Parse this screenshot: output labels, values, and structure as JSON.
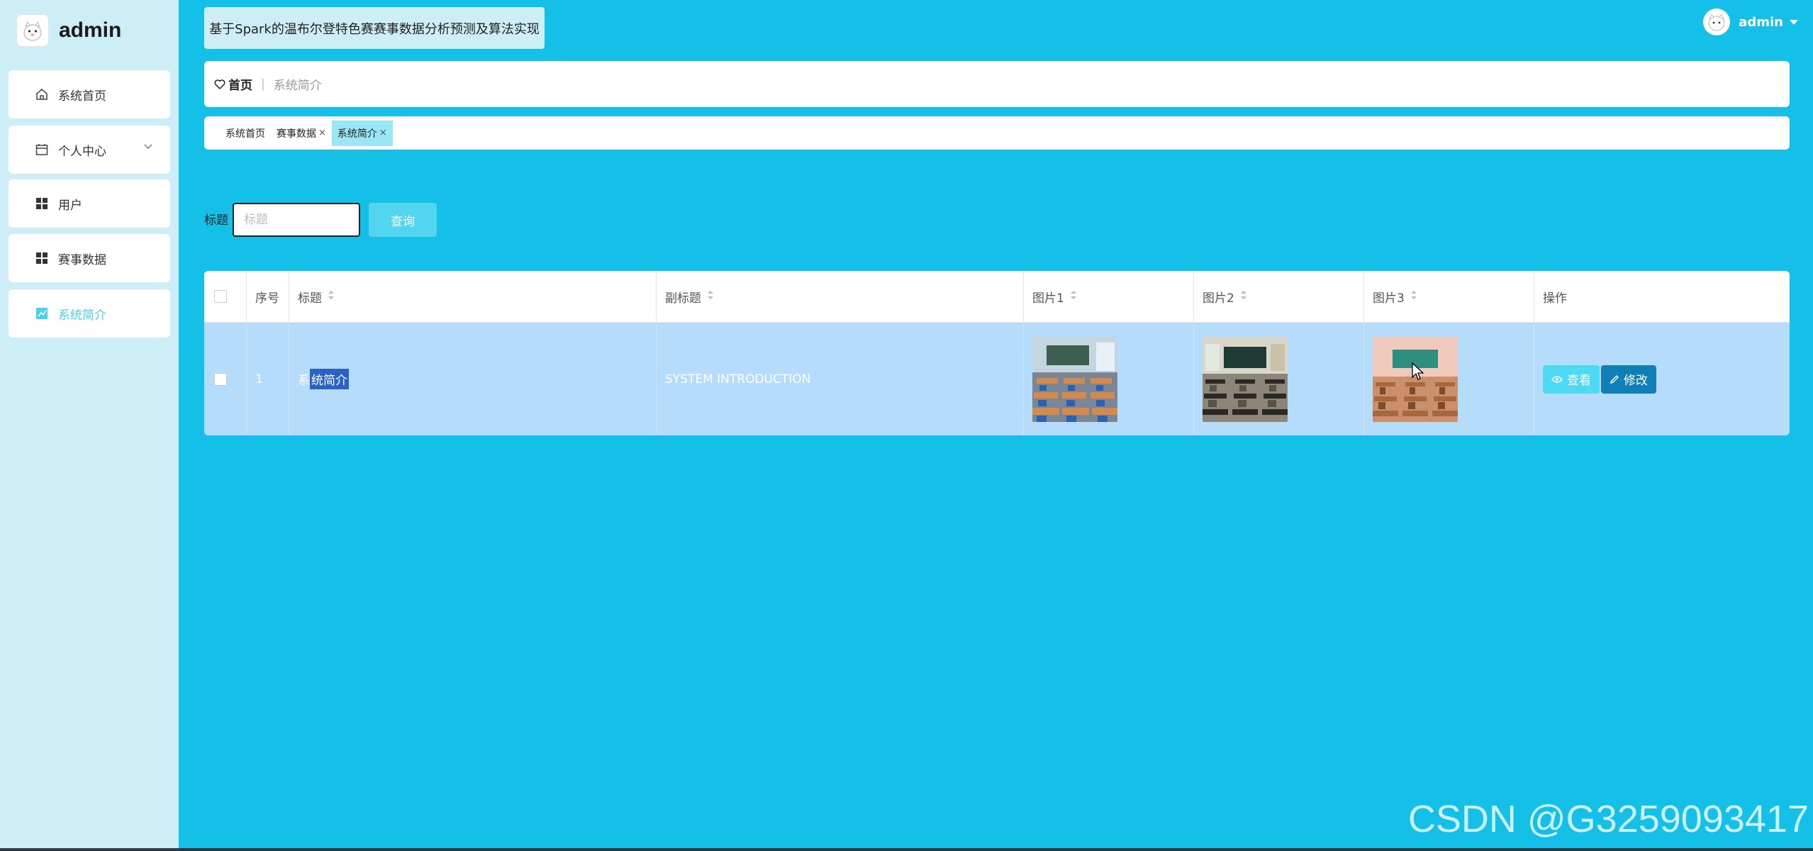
{
  "sidebar": {
    "brand": "admin",
    "items": [
      {
        "label": "系统首页",
        "icon": "home-icon"
      },
      {
        "label": "个人中心",
        "icon": "calendar-icon"
      },
      {
        "label": "用户",
        "icon": "grid-icon"
      },
      {
        "label": "赛事数据",
        "icon": "grid-icon"
      },
      {
        "label": "系统简介",
        "icon": "chart-icon"
      }
    ]
  },
  "header": {
    "app_title": "基于Spark的温布尔登特色赛赛事数据分析预测及算法实现",
    "user_name": "admin"
  },
  "breadcrumb": {
    "home": "首页",
    "separator": "|",
    "current": "系统简介"
  },
  "tags": [
    {
      "label": "系统首页",
      "close": ""
    },
    {
      "label": "赛事数据",
      "close": "×"
    },
    {
      "label": "系统简介",
      "close": "×"
    }
  ],
  "search": {
    "label": "标题",
    "placeholder": "标题",
    "button": "查询"
  },
  "table": {
    "headers": {
      "index": "序号",
      "title": "标题",
      "subtitle": "副标题",
      "pic1": "图片1",
      "pic2": "图片2",
      "pic3": "图片3",
      "actions": "操作"
    },
    "rows": [
      {
        "index": "1",
        "title_prefix": "系",
        "title_selected": "统简介",
        "subtitle": "SYSTEM INTRODUCTION",
        "view_label": "查看",
        "edit_label": "修改"
      }
    ]
  },
  "watermark": "CSDN @G3259093417",
  "colors": {
    "background": "#14c0e8",
    "sidebar": "#cdedf7",
    "active_menu_text": "#49d2ec",
    "row_highlight": "#b6dcfb",
    "view_button": "#4fdaf3",
    "edit_button": "#0f7fb6",
    "search_button": "#53d5ef"
  }
}
